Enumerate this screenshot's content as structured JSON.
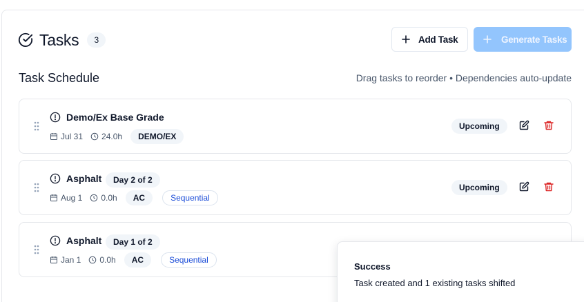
{
  "header": {
    "title": "Tasks",
    "count": "3"
  },
  "actions": {
    "add_label": "Add Task",
    "generate_label": "Generate Tasks"
  },
  "schedule": {
    "title": "Task Schedule",
    "hint": "Drag tasks to reorder • Dependencies auto-update"
  },
  "tasks": [
    {
      "name": "Demo/Ex Base Grade",
      "day": "",
      "date": "Jul 31",
      "duration": "24.0h",
      "code": "DEMO/EX",
      "sequential": "",
      "status": "Upcoming"
    },
    {
      "name": "Asphalt",
      "day": "Day 2 of 2",
      "date": "Aug 1",
      "duration": "0.0h",
      "code": "AC",
      "sequential": "Sequential",
      "status": "Upcoming"
    },
    {
      "name": "Asphalt",
      "day": "Day 1 of 2",
      "date": "Jan 1",
      "duration": "0.0h",
      "code": "AC",
      "sequential": "Sequential",
      "status": ""
    }
  ],
  "toast": {
    "title": "Success",
    "message": "Task created and 1 existing tasks shifted"
  },
  "colors": {
    "primary_disabled": "#93c5fd",
    "danger": "#dc2626",
    "link": "#1d4ed8"
  },
  "icons": [
    "circle-check-icon",
    "plus-icon",
    "grip-icon",
    "alert-circle-icon",
    "calendar-icon",
    "clock-icon",
    "edit-icon",
    "trash-icon"
  ]
}
